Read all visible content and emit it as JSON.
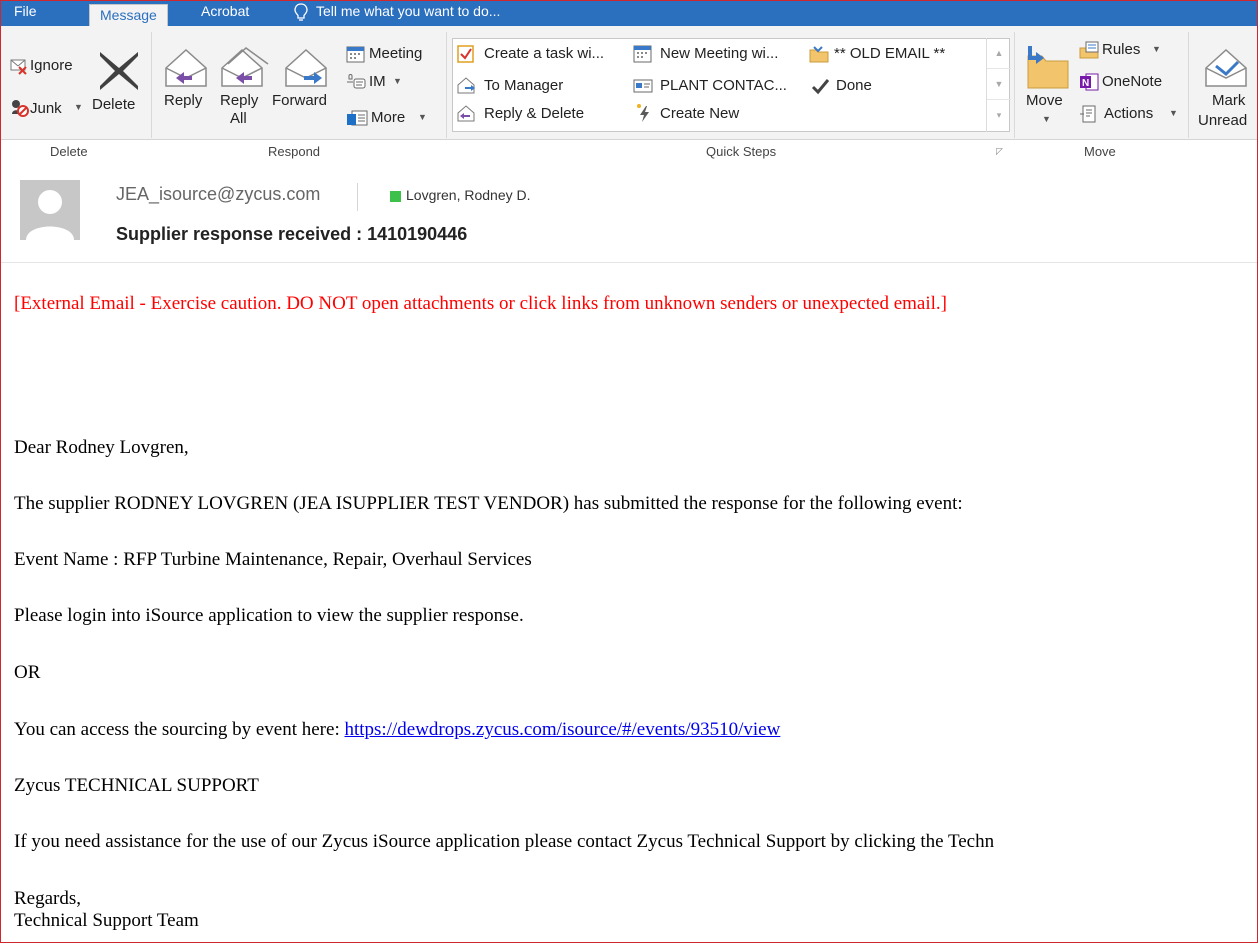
{
  "tabs": {
    "file": "File",
    "message": "Message",
    "acrobat": "Acrobat",
    "tell_me": "Tell me what you want to do..."
  },
  "ribbon": {
    "delete_group": {
      "ignore": "Ignore",
      "junk": "Junk",
      "delete": "Delete",
      "label": "Delete"
    },
    "respond_group": {
      "reply": "Reply",
      "reply_all_line1": "Reply",
      "reply_all_line2": "All",
      "forward": "Forward",
      "meeting": "Meeting",
      "im": "IM",
      "more": "More",
      "label": "Respond"
    },
    "quick_steps": {
      "items": [
        "Create a task wi...",
        "To Manager",
        "Reply & Delete",
        "New Meeting wi...",
        "PLANT CONTAC...",
        "Create New",
        "** OLD EMAIL **",
        "Done"
      ],
      "label": "Quick Steps"
    },
    "move_group": {
      "move": "Move",
      "rules": "Rules",
      "onenote": "OneNote",
      "actions": "Actions",
      "label": "Move"
    },
    "tags_group": {
      "mark_line1": "Mark",
      "mark_line2": "Unread"
    }
  },
  "header": {
    "sender": "JEA_isource@zycus.com",
    "recipient": "Lovgren, Rodney D.",
    "subject": "Supplier response received : 1410190446"
  },
  "body": {
    "warning": "[External Email - Exercise caution. DO NOT open attachments or click links from unknown senders or unexpected email.]",
    "greeting": "Dear Rodney Lovgren,",
    "line1": "The supplier RODNEY LOVGREN (JEA ISUPPLIER TEST VENDOR) has submitted the response for the following event:",
    "event": "Event Name : RFP Turbine Maintenance, Repair, Overhaul Services",
    "login": "Please login into iSource application to view the supplier response.",
    "or": "OR",
    "access_prefix": "You can access the sourcing by event here: ",
    "access_link": "https://dewdrops.zycus.com/isource/#/events/93510/view",
    "support_title": "Zycus TECHNICAL SUPPORT",
    "support_text": "If you need assistance for the use of our Zycus iSource application please contact Zycus Technical Support by clicking the Techn",
    "regards": "Regards,",
    "team": "Technical Support Team"
  },
  "colors": {
    "accent": "#2b6fbf",
    "warning": "#ff0000",
    "link": "#0000ee",
    "presence": "#3cc14a"
  }
}
